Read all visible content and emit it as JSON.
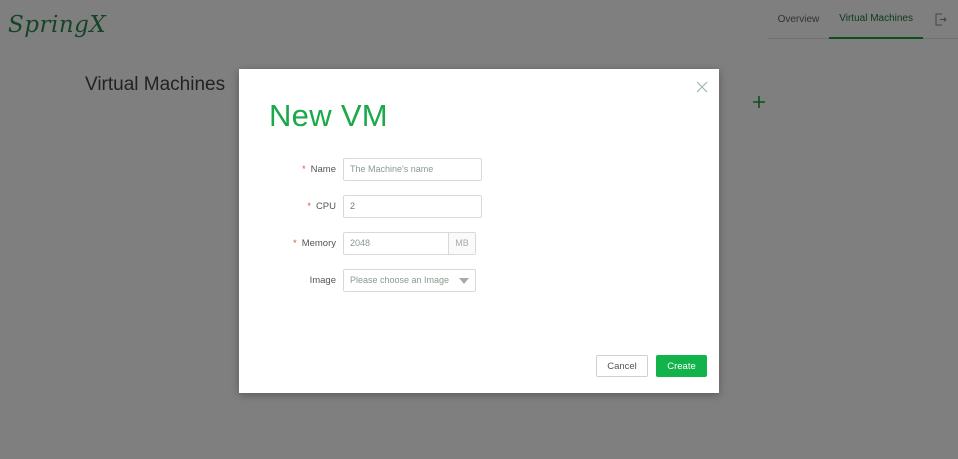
{
  "app": {
    "logo_text": "SpringX"
  },
  "nav": {
    "tabs": [
      {
        "label": "Overview",
        "active": false
      },
      {
        "label": "Virtual Machines",
        "active": true
      }
    ],
    "logout_icon": "logout-icon"
  },
  "page": {
    "title": "Virtual Machines",
    "add_icon": "plus-icon"
  },
  "modal": {
    "title": "New VM",
    "close_icon": "close-icon",
    "fields": {
      "name": {
        "label": "Name",
        "required": true,
        "placeholder": "The Machine's name",
        "value": ""
      },
      "cpu": {
        "label": "CPU",
        "required": true,
        "value": "2"
      },
      "memory": {
        "label": "Memory",
        "required": true,
        "value": "2048",
        "unit": "MB"
      },
      "image": {
        "label": "Image",
        "required": false,
        "placeholder": "Please choose an Image",
        "value": ""
      }
    },
    "buttons": {
      "cancel": "Cancel",
      "create": "Create"
    }
  },
  "colors": {
    "accent": "#13b34b",
    "title_green": "#1ba84a",
    "required_star": "#e74c3c",
    "overlay": "rgba(0,0,0,0.5)"
  }
}
